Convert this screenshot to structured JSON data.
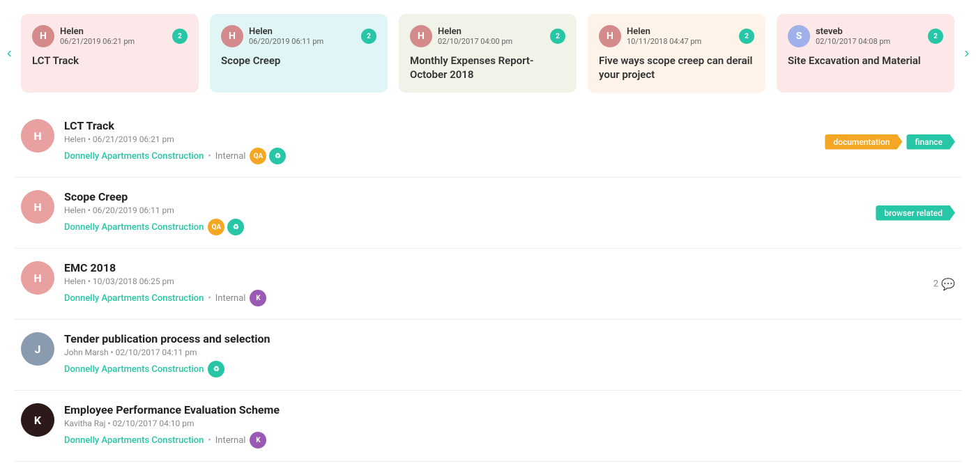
{
  "carousel": {
    "cards": [
      {
        "id": "card-1",
        "bg": "pink",
        "author": "Helen",
        "date": "06/21/2019 06:21 pm",
        "title": "LCT Track",
        "badge": "2",
        "avatar_initials": "H",
        "avatar_color": "#e8a0a0"
      },
      {
        "id": "card-2",
        "bg": "teal",
        "author": "Helen",
        "date": "06/20/2019 06:11 pm",
        "title": "Scope Creep",
        "badge": "2",
        "avatar_initials": "H",
        "avatar_color": "#e8a0a0"
      },
      {
        "id": "card-3",
        "bg": "green",
        "author": "Helen",
        "date": "02/10/2017 04:00 pm",
        "title": "Monthly Expenses Report- October 2018",
        "badge": "2",
        "avatar_initials": "H",
        "avatar_color": "#e8a0a0"
      },
      {
        "id": "card-4",
        "bg": "orange",
        "author": "Helen",
        "date": "10/11/2018 04:47 pm",
        "title": "Five ways scope creep can derail your project",
        "badge": "2",
        "avatar_initials": "H",
        "avatar_color": "#e8a0a0"
      },
      {
        "id": "card-5",
        "bg": "pink2",
        "author": "steveb",
        "date": "02/10/2017 04:08 pm",
        "title": "Site Excavation and Material",
        "badge": "2",
        "avatar_initials": "S",
        "avatar_color": "#a0b0e8"
      }
    ],
    "nav_left": "‹",
    "nav_right": "›"
  },
  "list": {
    "items": [
      {
        "id": "item-1",
        "title": "LCT Track",
        "author": "Helen",
        "date": "06/21/2019 06:21 pm",
        "project": "Donnelly Apartments Construction",
        "separator": "•",
        "internal": "Internal",
        "show_internal": true,
        "badges": [
          {
            "initials": "QA",
            "color": "orange"
          },
          {
            "initials": "♻",
            "color": "green"
          }
        ],
        "tags": [
          {
            "label": "documentation",
            "color": "orange"
          },
          {
            "label": "finance",
            "color": "teal"
          }
        ],
        "comment_count": null,
        "avatar_bg": "#e8a0a0",
        "avatar_initials": "H"
      },
      {
        "id": "item-2",
        "title": "Scope Creep",
        "author": "Helen",
        "date": "06/20/2019 06:11 pm",
        "project": "Donnelly Apartments Construction",
        "separator": null,
        "internal": null,
        "show_internal": false,
        "badges": [
          {
            "initials": "QA",
            "color": "orange"
          },
          {
            "initials": "♻",
            "color": "green"
          }
        ],
        "tags": [
          {
            "label": "browser related",
            "color": "teal"
          }
        ],
        "comment_count": null,
        "avatar_bg": "#e8a0a0",
        "avatar_initials": "H"
      },
      {
        "id": "item-3",
        "title": "EMC 2018",
        "author": "Helen",
        "date": "10/03/2018 06:25 pm",
        "project": "Donnelly Apartments Construction",
        "separator": "•",
        "internal": "Internal",
        "show_internal": true,
        "badges": [
          {
            "initials": "K",
            "color": "purple"
          }
        ],
        "tags": [],
        "comment_count": "2",
        "avatar_bg": "#e8a0a0",
        "avatar_initials": "H"
      },
      {
        "id": "item-4",
        "title": "Tender publication process and selection",
        "author": "John Marsh",
        "date": "02/10/2017 04:11 pm",
        "project": "Donnelly Apartments Construction",
        "separator": null,
        "internal": null,
        "show_internal": false,
        "badges": [
          {
            "initials": "♻",
            "color": "green"
          }
        ],
        "tags": [],
        "comment_count": null,
        "avatar_bg": "#8a9bb0",
        "avatar_initials": "J"
      },
      {
        "id": "item-5",
        "title": "Employee Performance Evaluation Scheme",
        "author": "Kavitha Raj",
        "date": "02/10/2017 04:10 pm",
        "project": "Donnelly Apartments Construction",
        "separator": "•",
        "internal": "Internal",
        "show_internal": true,
        "badges": [
          {
            "initials": "K",
            "color": "purple"
          }
        ],
        "tags": [],
        "comment_count": null,
        "avatar_bg": "#2c1a1a",
        "avatar_initials": "K"
      }
    ]
  }
}
